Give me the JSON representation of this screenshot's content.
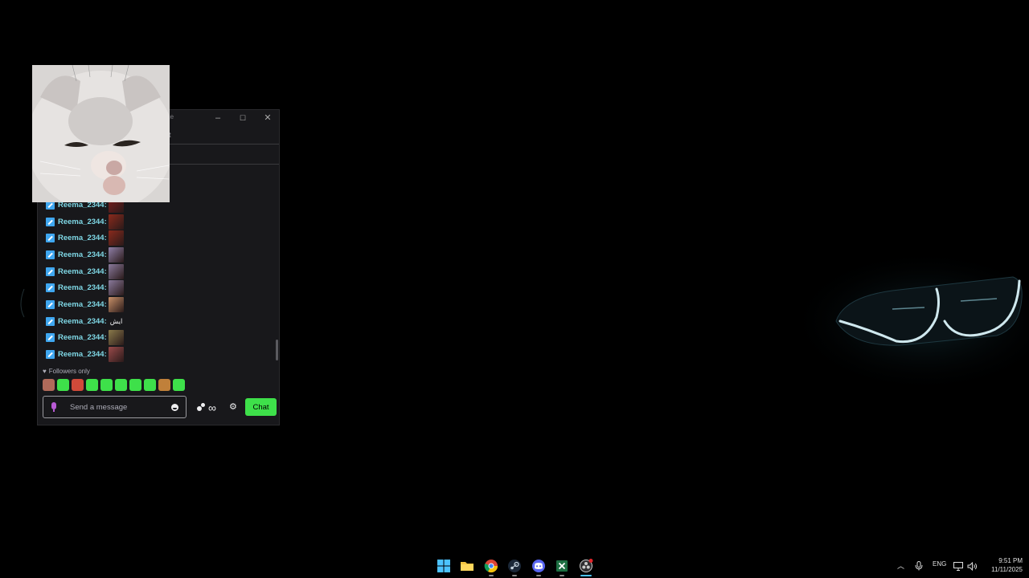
{
  "window": {
    "title": "me",
    "tab_text": "t",
    "minimize_glyph": "–",
    "maximize_glyph": "☐",
    "close_glyph": "✕"
  },
  "chat": {
    "messages": [
      {
        "user": "Reema_2344",
        "emote": "#7a1d1d",
        "text": ""
      },
      {
        "user": "Reema_2344",
        "emote": "#8b2a1c",
        "text": ""
      },
      {
        "user": "Reema_2344",
        "emote": "#8b2a1c",
        "text": ""
      },
      {
        "user": "Reema_2344",
        "emote": "#9080a8",
        "text": ""
      },
      {
        "user": "Reema_2344",
        "emote": "#8a7a9c",
        "text": ""
      },
      {
        "user": "Reema_2344",
        "emote": "#8a7a9c",
        "text": ""
      },
      {
        "user": "Reema_2344",
        "emote": "#c89068",
        "text": ""
      },
      {
        "user": "Reema_2344",
        "emote": "",
        "text": "ايش"
      },
      {
        "user": "Reema_2344",
        "emote": "#8a7a4a",
        "text": ""
      },
      {
        "user": "Reema_2344",
        "emote": "#9a4a4a",
        "text": ""
      }
    ],
    "followers_only": "Followers only",
    "emote_bar_colors": [
      "#b06a5a",
      "#3ee04a",
      "#d04a3a",
      "#3ee04a",
      "#3ee04a",
      "#3ee04a",
      "#3ee04a",
      "#3ee04a",
      "#c0803a",
      "#3ee04a"
    ],
    "input_placeholder": "Send a message",
    "chat_button": "Chat",
    "icons": [
      "mic-icon",
      "smile-icon",
      "channel-points-icon",
      "infinity-icon",
      "gear-icon"
    ]
  },
  "taskbar": {
    "apps": [
      "windows-start",
      "file-explorer",
      "chrome",
      "steam",
      "discord",
      "excel",
      "obs"
    ],
    "language": "ENG",
    "time": "9:51 PM",
    "date": "11/11/2025"
  },
  "colors": {
    "accent_green": "#3ee04a",
    "username": "#7fd8e6",
    "badge_blue": "#3fa7f0"
  }
}
